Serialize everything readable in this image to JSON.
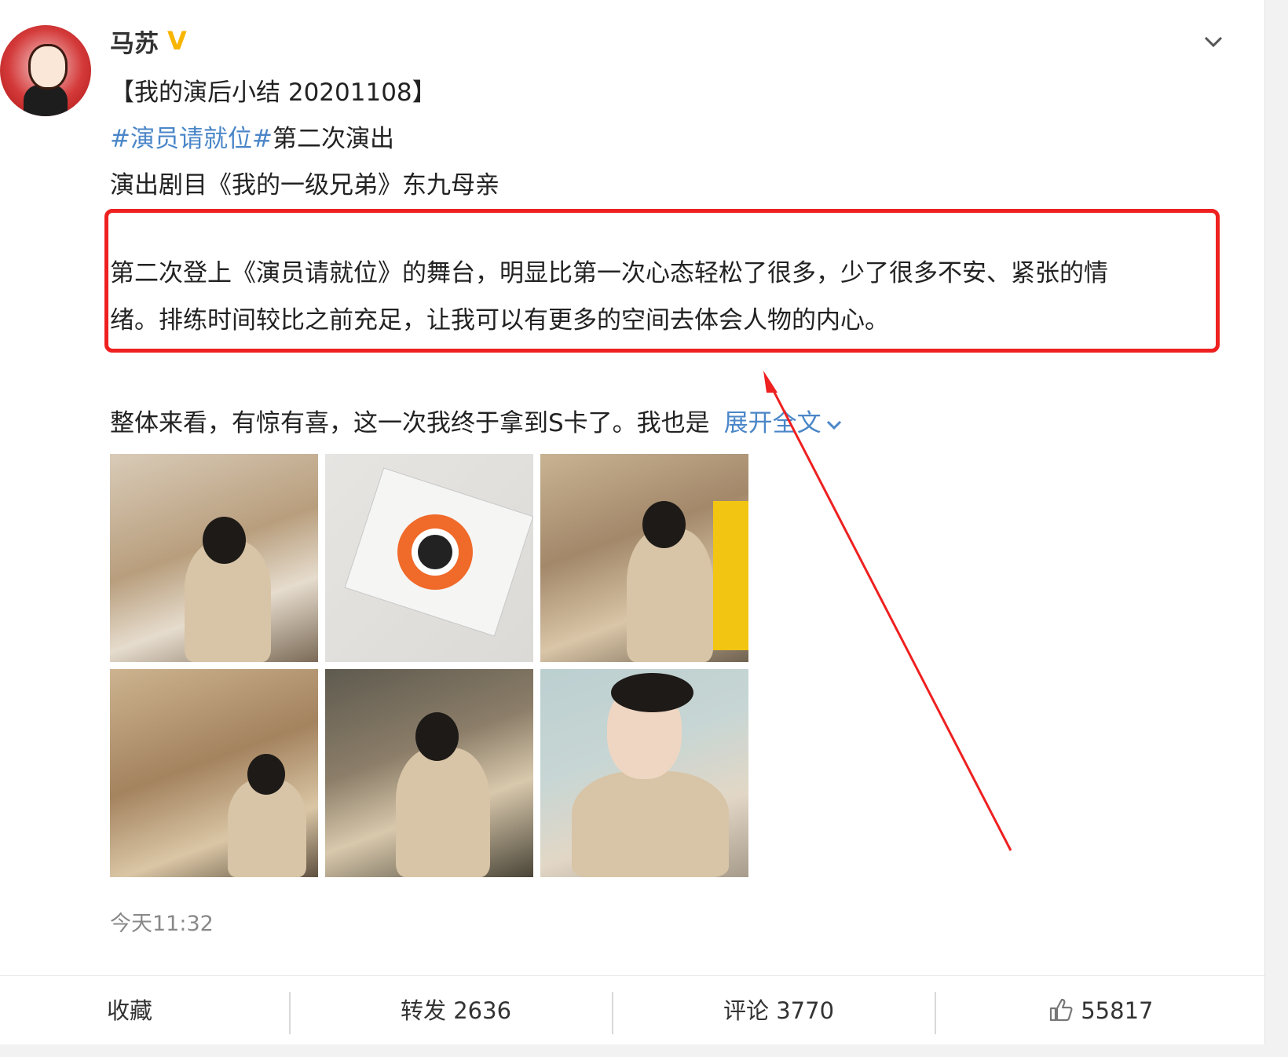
{
  "post": {
    "author_name": "马苏",
    "verified_badge": "V",
    "lines": {
      "line1": "【我的演后小结 20201108】",
      "tag": "#演员请就位#",
      "line2_rest": "第二次演出",
      "line3": "演出剧目《我的一级兄弟》东九母亲",
      "para1": "第二次登上《演员请就位》的舞台，明显比第一次心态轻松了很多，少了很多不安、紧张的情",
      "para2": "绪。排练时间较比之前充足，让我可以有更多的空间去体会人物的内心。",
      "line6": "整体来看，有惊有喜，这一次我终于拿到S卡了。我也是",
      "expand_label": "展开全文"
    },
    "timestamp": "今天11:32"
  },
  "actions": {
    "favorite": "收藏",
    "repost": "转发 2636",
    "comment": "评论 3770",
    "like_count": "55817"
  },
  "icons": {
    "menu": "chevron-down-icon",
    "expand": "chevron-down-icon",
    "like": "thumbs-up-icon"
  },
  "colors": {
    "link": "#4a86c8",
    "highlight": "#ee2020",
    "verified": "#f7b500"
  }
}
